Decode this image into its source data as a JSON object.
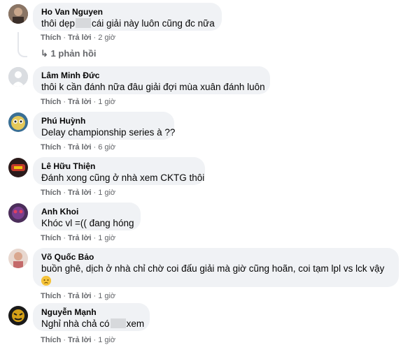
{
  "comments": [
    {
      "name": "Ho Van Nguyen",
      "text_before": "thôi dẹp",
      "text_after": "cái giải này luôn cũng đc nữa",
      "time": "2 giờ",
      "replies": "1 phản hồi"
    },
    {
      "name": "Lâm Minh Đức",
      "text": "thôi k cần đánh nữa đâu giải đợi mùa xuân đánh luôn",
      "time": "1 giờ"
    },
    {
      "name": "Phú Huỳnh",
      "text": "Delay championship series à ??",
      "time": "6 giờ"
    },
    {
      "name": "Lê Hữu Thiện",
      "text": "Đánh xong cũng ở nhà xem CKTG thôi",
      "time": "1 giờ"
    },
    {
      "name": "Anh Khoi",
      "text": "Khóc vl =(( đang hóng",
      "time": "1 giờ"
    },
    {
      "name": "Võ Quốc Bảo",
      "text": "buồn ghê, dịch ở nhà chỉ chờ coi đấu giải mà giờ cũng hoãn, coi tạm lpl vs lck vậy",
      "time": "1 giờ"
    },
    {
      "name": "Nguyễn Mạnh",
      "text_before": "Nghỉ nhà chả có",
      "text_after": "xem",
      "time": "1 giờ"
    }
  ],
  "actions": {
    "like": "Thích",
    "reply": "Trả lời",
    "sep": "·"
  },
  "icons": {
    "reply_arrow": "reply-arrow-icon",
    "emoji": "sad-face-emoji-icon"
  },
  "colors": {
    "bubble": "#f0f2f5",
    "meta": "#65676b"
  }
}
